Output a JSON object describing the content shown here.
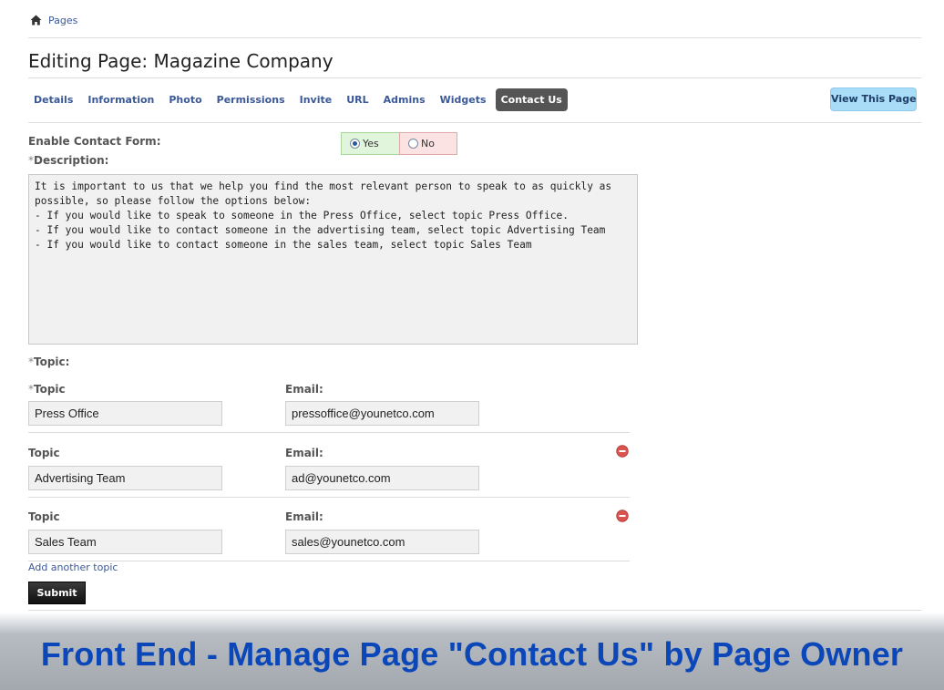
{
  "breadcrumb": {
    "icon": "home-icon",
    "label": "Pages"
  },
  "page_title": "Editing Page: Magazine Company",
  "tabs": [
    {
      "label": "Details",
      "active": false
    },
    {
      "label": "Information",
      "active": false
    },
    {
      "label": "Photo",
      "active": false
    },
    {
      "label": "Permissions",
      "active": false
    },
    {
      "label": "Invite",
      "active": false
    },
    {
      "label": "URL",
      "active": false
    },
    {
      "label": "Admins",
      "active": false
    },
    {
      "label": "Widgets",
      "active": false
    },
    {
      "label": "Contact Us",
      "active": true
    }
  ],
  "view_page_button": "View This Page",
  "form": {
    "enable_label": "Enable Contact Form:",
    "enable_options": [
      {
        "label": "Yes",
        "selected": true
      },
      {
        "label": "No",
        "selected": false
      }
    ],
    "required_mark": "*",
    "description_label": "Description:",
    "description_value": "It is important to us that we help you find the most relevant person to speak to as quickly as possible, so please follow the options below:\n- If you would like to speak to someone in the Press Office, select topic Press Office.\n- If you would like to contact someone in the advertising team, select topic Advertising Team\n- If you would like to contact someone in the sales team, select topic Sales Team",
    "topic_section_label": "Topic:",
    "topics": [
      {
        "topic_label": "Topic",
        "required": true,
        "email_label": "Email:",
        "topic": "Press Office",
        "email": "pressoffice@younetco.com",
        "removable": false
      },
      {
        "topic_label": "Topic",
        "required": false,
        "email_label": "Email:",
        "topic": "Advertising Team",
        "email": "ad@younetco.com",
        "removable": true
      },
      {
        "topic_label": "Topic",
        "required": false,
        "email_label": "Email:",
        "topic": "Sales Team",
        "email": "sales@younetco.com",
        "removable": true
      }
    ],
    "add_topic_link": "Add another topic",
    "submit_label": "Submit"
  },
  "caption": "Front End - Manage Page \"Contact Us\" by Page Owner",
  "colors": {
    "link": "#3b5998",
    "active_tab": "#555555",
    "view_button": "#a9dcf6",
    "yes_bg": "#e1f5dd",
    "no_bg": "#fbe3e3",
    "caption_text": "#0b47b8",
    "remove_icon": "#d9534f"
  }
}
